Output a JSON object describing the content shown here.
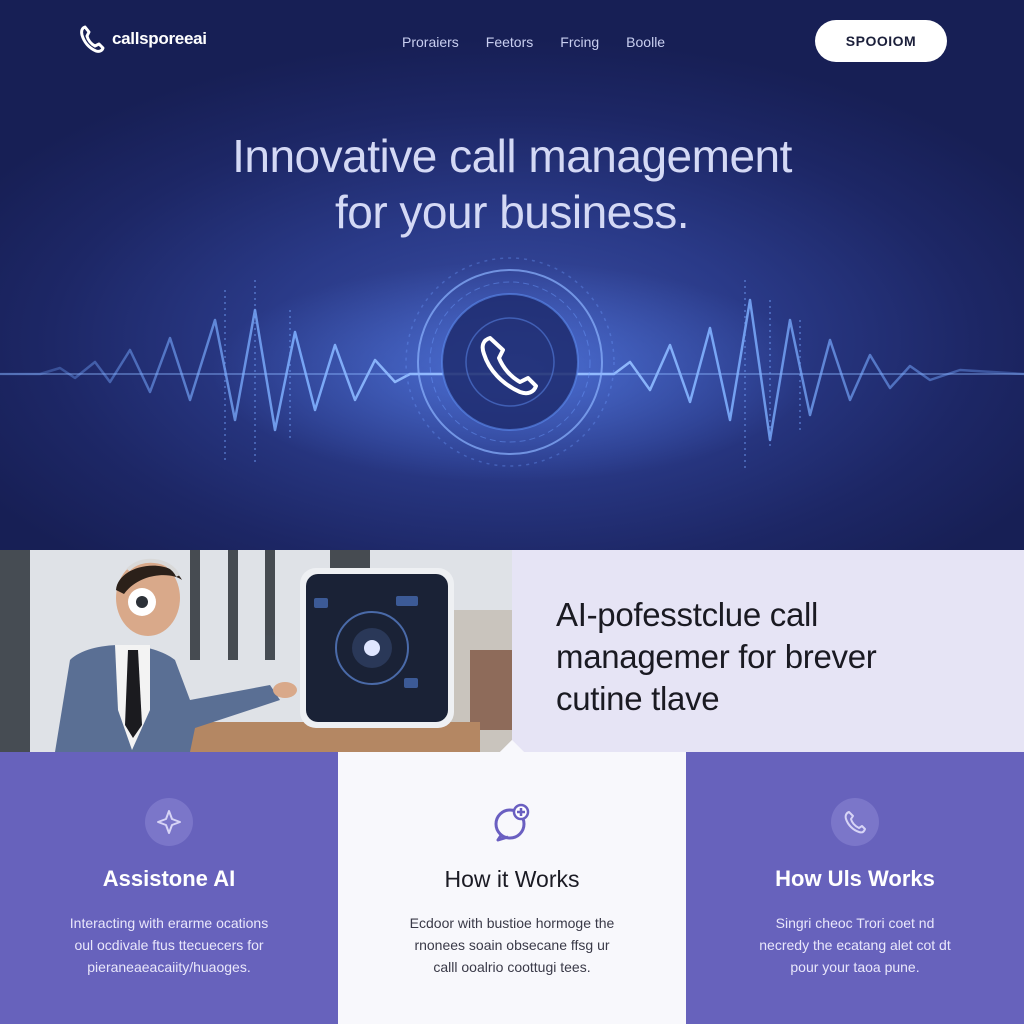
{
  "brand": {
    "name": "callsporeeai",
    "logo_icon": "phone-icon"
  },
  "nav": {
    "items": [
      "Proraiers",
      "Feetors",
      "Frcing",
      "Boolle"
    ]
  },
  "cta": {
    "label": "SPOOIOM"
  },
  "hero": {
    "title_lines": [
      "Innovative call management",
      "for your business."
    ],
    "center_icon": "phone-icon"
  },
  "tagline": {
    "lines": [
      "AI-pofesstclue call",
      "managemer for brever",
      "cutine tlave"
    ]
  },
  "cards": [
    {
      "icon": "sparkle-icon",
      "title": "Assistone AI",
      "text_lines": [
        "Interacting with erarme ocations",
        "oul ocdivale ftus ttecuecers for",
        "pieraneaeacaiity/huaoges."
      ]
    },
    {
      "icon": "chat-plus-icon",
      "title": "How it Works",
      "text_lines": [
        "Ecdoor with bustioe hormoge the",
        "rnonees soain obsecane ffsg ur",
        "calll ooalrio coottugi tees."
      ]
    },
    {
      "icon": "phone-circle-icon",
      "title": "How Uls Works",
      "text_lines": [
        "Singri cheoc Trori coet nd",
        "necredy the ecatang alet cot dt",
        "pour your taoa pune."
      ]
    }
  ],
  "colors": {
    "hero_bg": "#1d2766",
    "accent": "#4a7ff0",
    "card_purple": "#6762bc",
    "tagline_bg": "#e6e4f5"
  }
}
